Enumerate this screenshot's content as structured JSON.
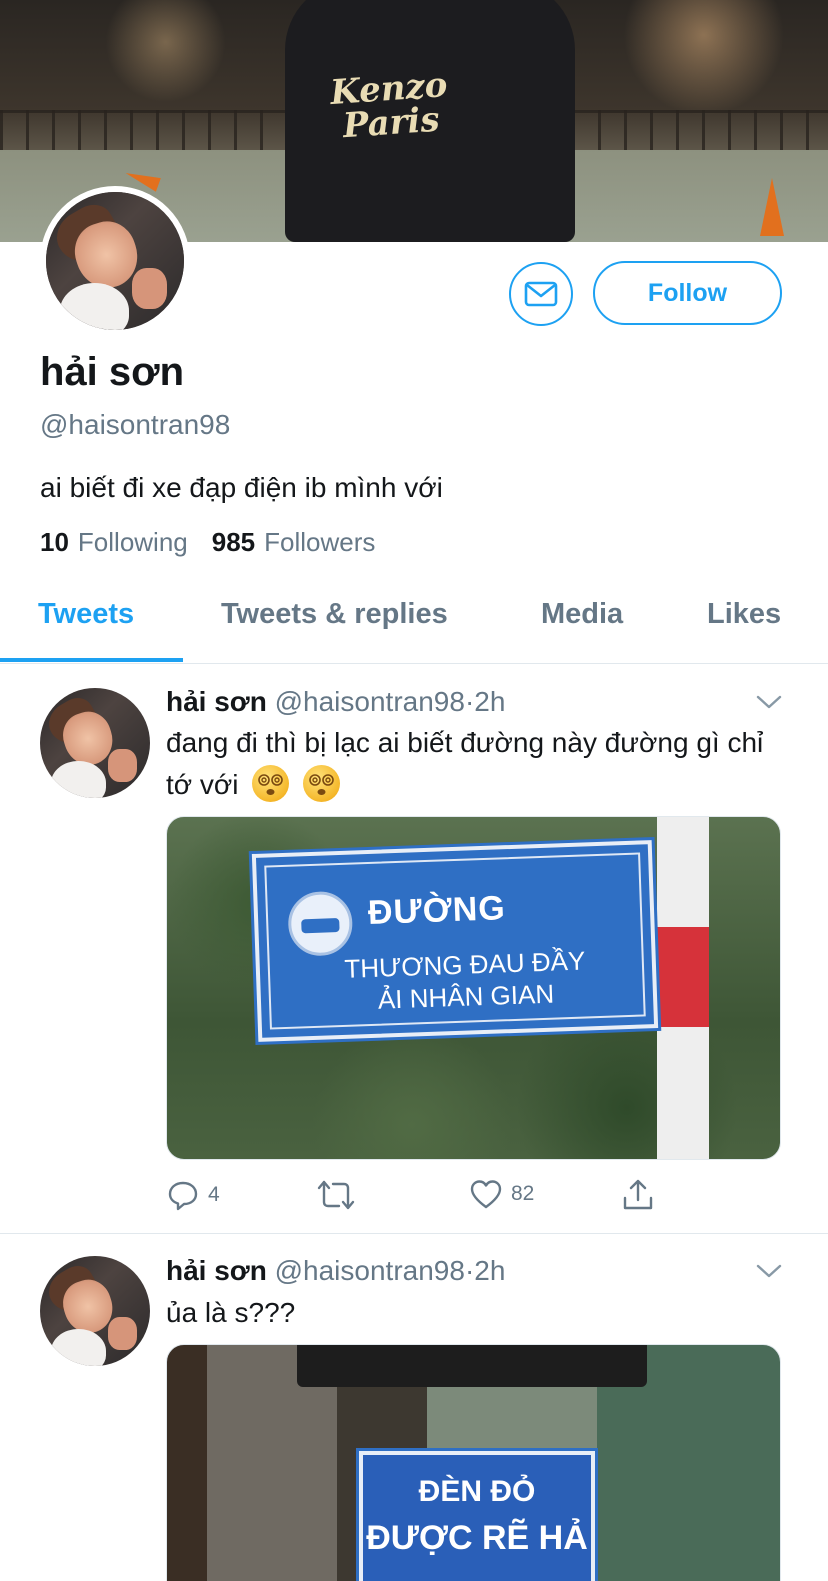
{
  "profile": {
    "banner_hoodie_text": "Kenzo Paris",
    "display_name": "hải sơn",
    "handle": "@haisontran98",
    "bio": "ai biết đi xe đạp điện ib mình với",
    "following_count": "10",
    "following_label": "Following",
    "followers_count": "985",
    "followers_label": "Followers",
    "follow_label": "Follow",
    "dm_icon": "envelope-icon"
  },
  "tabs": [
    {
      "label": "Tweets",
      "active": true
    },
    {
      "label": "Tweets & replies",
      "active": false
    },
    {
      "label": "Media",
      "active": false
    },
    {
      "label": "Likes",
      "active": false
    }
  ],
  "tweets": [
    {
      "name": "hải sơn",
      "handle": "@haisontran98",
      "sep": "·",
      "time": "2h",
      "text": "đang đi thì bị lạc ai biết đường này đường gì chỉ tớ với",
      "emojis": [
        "dizzy-face-emoji",
        "dizzy-face-emoji"
      ],
      "image": {
        "sign_line1": "ĐƯỜNG",
        "sign_line2": "THƯƠNG ĐAU ĐẦY",
        "sign_line3": "ẢI NHÂN GIAN"
      },
      "reply_count": "4",
      "retweet_count": "",
      "like_count": "82"
    },
    {
      "name": "hải sơn",
      "handle": "@haisontran98",
      "sep": "·",
      "time": "2h",
      "text": "ủa là s???",
      "image": {
        "sign_line1": "ĐÈN ĐỎ",
        "sign_line2": "ĐƯỢC RẼ  HẢ"
      }
    }
  ],
  "colors": {
    "accent": "#1da1f2",
    "secondary_text": "#657786",
    "primary_text": "#14171a",
    "divider": "#e1e8ed"
  }
}
